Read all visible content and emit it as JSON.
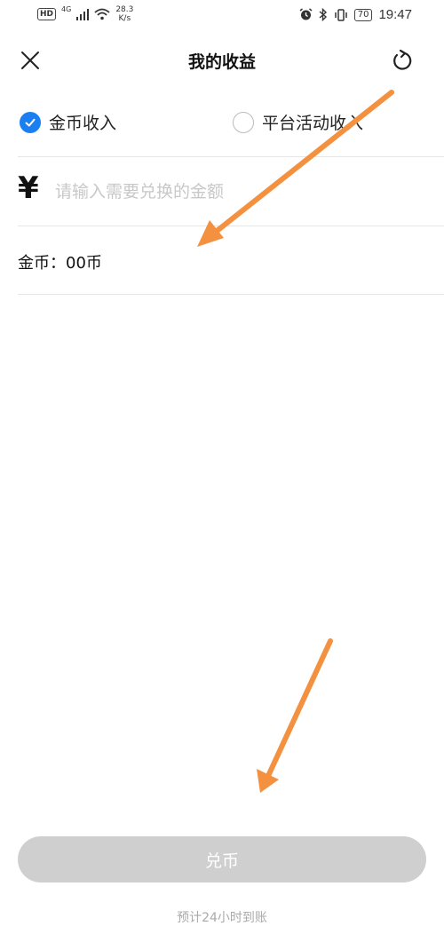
{
  "status_bar": {
    "hd": "HD",
    "network": "4G",
    "speed_value": "28.3",
    "speed_unit": "K/s",
    "battery": "70",
    "time": "19:47"
  },
  "header": {
    "title": "我的收益"
  },
  "income_type": {
    "options": [
      {
        "label": "金币收入",
        "selected": true
      },
      {
        "label": "平台活动收入",
        "selected": false
      }
    ]
  },
  "amount": {
    "currency_symbol": "¥",
    "placeholder": "请输入需要兑换的金额",
    "value": ""
  },
  "coins": {
    "label": "金币：",
    "value": "00币"
  },
  "actions": {
    "exchange_label": "兑币"
  },
  "footnote": "预计24小时到账",
  "colors": {
    "accent": "#1a7ff0",
    "button_disabled": "#cfcfcf",
    "annotation_arrow": "#f39140"
  }
}
